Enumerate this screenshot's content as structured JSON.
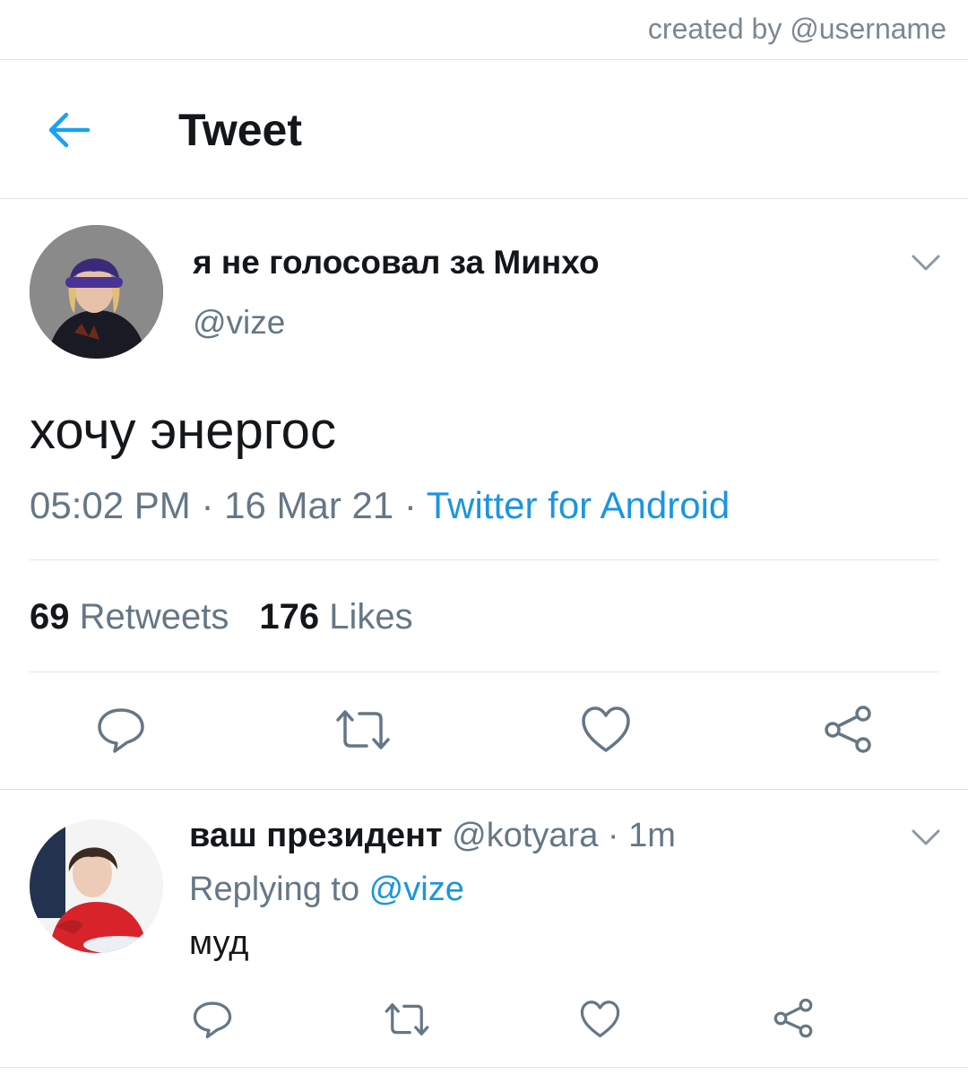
{
  "credit": "created by @username",
  "header": {
    "title": "Tweet",
    "back_icon": "arrow-left-icon",
    "accent_color": "#1da1f2"
  },
  "tweet": {
    "display_name": "я не голосовал за Минхо",
    "handle": "@vize",
    "text": "хочу энергос",
    "time": "05:02 PM",
    "sep1": " · ",
    "date": "16 Mar 21",
    "sep2": " · ",
    "source": "Twitter for Android",
    "retweets_count": "69",
    "retweets_label": "Retweets",
    "likes_count": "176",
    "likes_label": "Likes",
    "actions": [
      "reply-icon",
      "retweet-icon",
      "like-icon",
      "share-icon"
    ]
  },
  "reply": {
    "display_name": "ваш президент",
    "handle": "@kotyara",
    "sep": " · ",
    "time": "1m",
    "replying_to_label": "Replying to ",
    "replying_to_handle": "@vize",
    "text": "муд",
    "actions": [
      "reply-icon",
      "retweet-icon",
      "like-icon",
      "share-icon"
    ]
  },
  "colors": {
    "link": "#1b95e0",
    "secondary_text": "#657786",
    "primary_text": "#14171a",
    "divider": "#dfe3e6"
  }
}
